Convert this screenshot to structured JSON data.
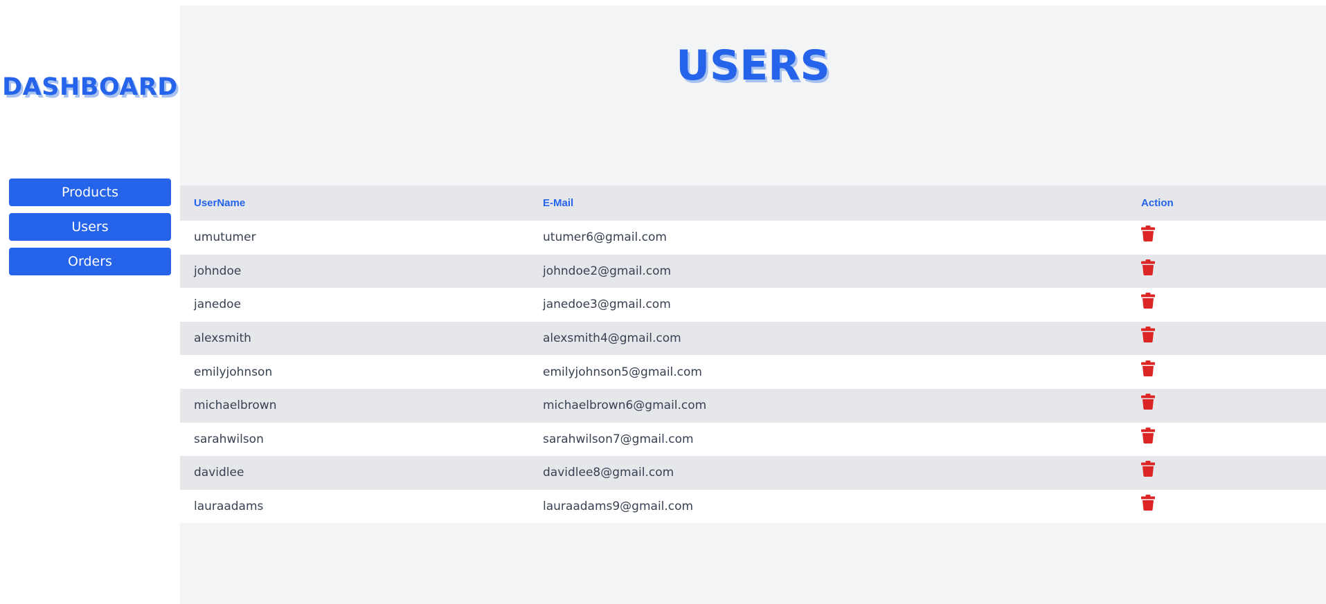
{
  "sidebar": {
    "brand": "DASHBOARD",
    "nav": [
      {
        "label": "Products"
      },
      {
        "label": "Users"
      },
      {
        "label": "Orders"
      }
    ]
  },
  "main": {
    "title": "USERS",
    "table": {
      "headers": {
        "username": "UserName",
        "email": "E-Mail",
        "action": "Action"
      },
      "rows": [
        {
          "username": "umutumer",
          "email": "utumer6@gmail.com"
        },
        {
          "username": "johndoe",
          "email": "johndoe2@gmail.com"
        },
        {
          "username": "janedoe",
          "email": "janedoe3@gmail.com"
        },
        {
          "username": "alexsmith",
          "email": "alexsmith4@gmail.com"
        },
        {
          "username": "emilyjohnson",
          "email": "emilyjohnson5@gmail.com"
        },
        {
          "username": "michaelbrown",
          "email": "michaelbrown6@gmail.com"
        },
        {
          "username": "sarahwilson",
          "email": "sarahwilson7@gmail.com"
        },
        {
          "username": "davidlee",
          "email": "davidlee8@gmail.com"
        },
        {
          "username": "lauraadams",
          "email": "lauraadams9@gmail.com"
        }
      ]
    },
    "action_icon": "trash-icon"
  },
  "colors": {
    "accent": "#2563eb",
    "danger": "#dc2626",
    "background": "#f3f4f6",
    "row_alt": "#e5e7eb"
  }
}
